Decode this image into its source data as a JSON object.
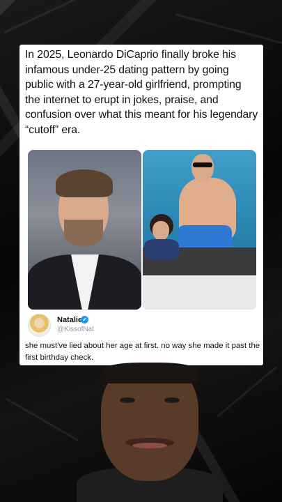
{
  "post": {
    "caption": "In 2025, Leonardo DiCaprio finally broke his infamous under-25 dating pattern by going public with a 27-year-old girlfriend, prompting the internet to erupt in jokes, praise, and confusion over what this meant for his legendary “cutoff” era."
  },
  "tweet": {
    "name": "Natalie",
    "handle": "@KissofNat",
    "verified_icon": "verified-badge-icon",
    "text": "she must've lied about her age at first. no way she made it past the first birthday check."
  },
  "colors": {
    "card_bg": "#ffffff",
    "verified": "#1d9bf0",
    "handle": "#8b98a5",
    "background": "#0b0b0b"
  }
}
